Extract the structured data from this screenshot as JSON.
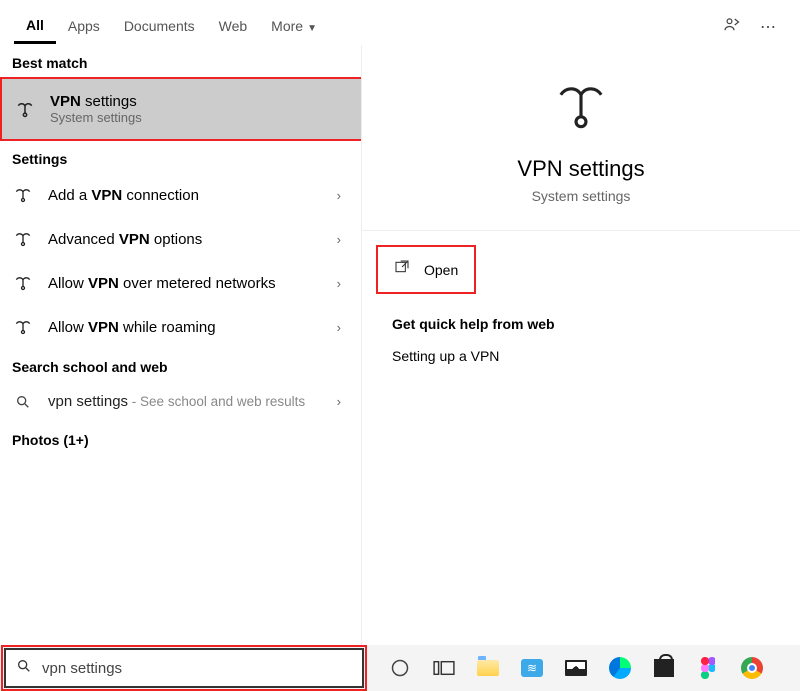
{
  "tabs": [
    "All",
    "Apps",
    "Documents",
    "Web",
    "More"
  ],
  "active_tab_index": 0,
  "left": {
    "best_match_header": "Best match",
    "best_match": {
      "title_html": "VPN settings",
      "title_bold": "VPN",
      "title_rest": " settings",
      "subtitle": "System settings"
    },
    "settings_header": "Settings",
    "settings_items": [
      {
        "pre": "Add a ",
        "bold": "VPN",
        "post": " connection"
      },
      {
        "pre": "Advanced ",
        "bold": "VPN",
        "post": " options"
      },
      {
        "pre": "Allow ",
        "bold": "VPN",
        "post": " over metered networks"
      },
      {
        "pre": "Allow ",
        "bold": "VPN",
        "post": " while roaming"
      }
    ],
    "web_header": "Search school and web",
    "web_item": {
      "primary": "vpn settings",
      "secondary": " - See school and web results"
    },
    "photos_header": "Photos (1+)"
  },
  "right": {
    "title": "VPN settings",
    "subtitle": "System settings",
    "open_label": "Open",
    "help_header": "Get quick help from web",
    "help_items": [
      "Setting up a VPN"
    ]
  },
  "search_query": "vpn settings"
}
